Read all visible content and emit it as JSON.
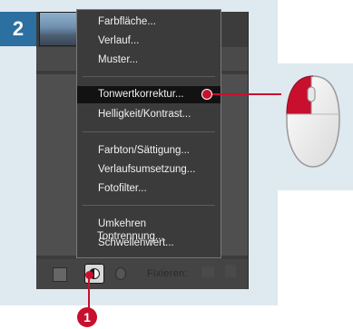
{
  "step_badge": "2",
  "callout_number": "1",
  "bottom_bar": {
    "fixieren_label": "Fixieren:"
  },
  "menu": {
    "groups": [
      [
        "Farbfläche...",
        "Verlauf...",
        "Muster..."
      ],
      [
        "Tonwertkorrektur...",
        "Helligkeit/Kontrast..."
      ],
      [
        "Farbton/Sättigung...",
        "Verlaufsumsetzung...",
        "Fotofilter..."
      ],
      [
        "Umkehren",
        "Schwellenwert...",
        "Tontrennung..."
      ]
    ],
    "highlighted_item": "Tonwertkorrektur..."
  },
  "icons": {
    "mask": "layer-mask-icon",
    "adjustment": "adjustment-layer-icon",
    "folder": "new-group-icon",
    "lock": "lock-icon",
    "mouse": "mouse-left-click-icon"
  },
  "colors": {
    "accent_blue": "#2c6fa1",
    "callout_red": "#c8102e",
    "panel_bg": "#dfe9f0",
    "menu_bg": "#3b3b3b",
    "menu_highlight": "#121212"
  }
}
